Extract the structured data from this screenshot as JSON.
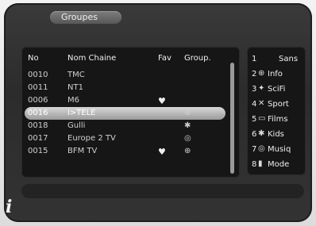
{
  "header": {
    "title": "Groupes"
  },
  "columns": {
    "no": "No",
    "name": "Nom Chaine",
    "fav": "Fav",
    "group": "Group."
  },
  "rows": [
    {
      "no": "0010",
      "name": "TMC",
      "fav": "",
      "group": ""
    },
    {
      "no": "0011",
      "name": "NT1",
      "fav": "",
      "group": ""
    },
    {
      "no": "0006",
      "name": "M6",
      "fav": "♥",
      "group": ""
    },
    {
      "no": "0016",
      "name": "i>TELE",
      "fav": "",
      "group": "⊕",
      "selected": true
    },
    {
      "no": "0018",
      "name": "Gulli",
      "fav": "",
      "group": "✱"
    },
    {
      "no": "0017",
      "name": "Europe 2 TV",
      "fav": "",
      "group": "◎"
    },
    {
      "no": "0015",
      "name": "BFM TV",
      "fav": "♥",
      "group": "⊕"
    }
  ],
  "groups": [
    {
      "num": "1",
      "icon": "",
      "label": "Sans"
    },
    {
      "num": "2",
      "icon": "⊕",
      "label": "Info"
    },
    {
      "num": "3",
      "icon": "✦",
      "label": "SciFi"
    },
    {
      "num": "4",
      "icon": "✕",
      "label": "Sport"
    },
    {
      "num": "5",
      "icon": "▭",
      "label": "Films"
    },
    {
      "num": "6",
      "icon": "✱",
      "label": "Kids"
    },
    {
      "num": "7",
      "icon": "◎",
      "label": "Musiq"
    },
    {
      "num": "8",
      "icon": "▮",
      "label": "Mode"
    }
  ],
  "footer": {
    "info": "i"
  }
}
